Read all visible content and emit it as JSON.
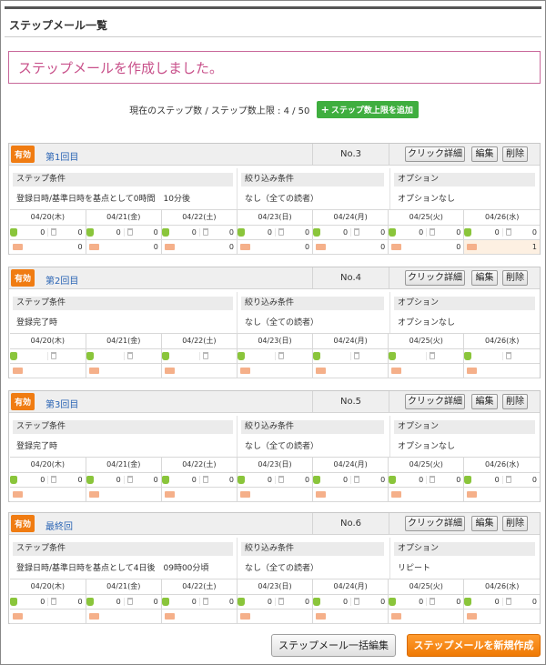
{
  "page": {
    "title": "ステップメール一覧",
    "notice": "ステップメールを作成しました。",
    "count_text": "現在のステップ数 / ステップ数上限 :  4 / 50",
    "add_limit_button": "ステップ数上限を追加"
  },
  "labels": {
    "step_condition": "ステップ条件",
    "filter_condition": "絞り込み条件",
    "option": "オプション",
    "click_detail": "クリック詳細",
    "edit": "編集",
    "delete": "削除"
  },
  "dates": [
    "04/20(木)",
    "04/21(金)",
    "04/22(土)",
    "04/23(日)",
    "04/24(月)",
    "04/25(火)",
    "04/26(水)"
  ],
  "steps": [
    {
      "status": "有効",
      "name": "第1回目",
      "no": "No.3",
      "step_condition": "登録日時/基準日時を基点として0時間　10分後",
      "filter": "なし（全ての読者）",
      "option": "オプションなし",
      "days": [
        {
          "a": "0",
          "b": "0",
          "mail": "0"
        },
        {
          "a": "0",
          "b": "0",
          "mail": "0"
        },
        {
          "a": "0",
          "b": "0",
          "mail": "0"
        },
        {
          "a": "0",
          "b": "0",
          "mail": "0"
        },
        {
          "a": "0",
          "b": "0",
          "mail": "0"
        },
        {
          "a": "0",
          "b": "0",
          "mail": "0"
        },
        {
          "a": "0",
          "b": "0",
          "mail": "1"
        }
      ]
    },
    {
      "status": "有効",
      "name": "第2回目",
      "no": "No.4",
      "step_condition": "登録完了時",
      "filter": "なし（全ての読者）",
      "option": "オプションなし",
      "days": [
        {},
        {},
        {},
        {},
        {},
        {},
        {}
      ]
    },
    {
      "status": "有効",
      "name": "第3回目",
      "no": "No.5",
      "step_condition": "登録完了時",
      "filter": "なし（全ての読者）",
      "option": "オプションなし",
      "days": [
        {
          "a": "0",
          "b": "0"
        },
        {
          "a": "0",
          "b": "0"
        },
        {
          "a": "0",
          "b": "0"
        },
        {
          "a": "0",
          "b": "0"
        },
        {
          "a": "0",
          "b": "0"
        },
        {
          "a": "0",
          "b": "0"
        },
        {
          "a": "0",
          "b": "0"
        }
      ]
    },
    {
      "status": "有効",
      "name": "最終回",
      "no": "No.6",
      "step_condition": "登録日時/基準日時を基点として4日後　09時00分頃",
      "filter": "なし（全ての読者）",
      "option": "リピート",
      "days": [
        {
          "a": "0",
          "b": "0"
        },
        {
          "a": "0",
          "b": "0"
        },
        {
          "a": "0",
          "b": "0"
        },
        {
          "a": "0",
          "b": "0"
        },
        {
          "a": "0",
          "b": "0"
        },
        {
          "a": "0",
          "b": "0"
        },
        {
          "a": "0",
          "b": "0"
        }
      ]
    }
  ],
  "footer": {
    "bulk_edit": "ステップメール一括編集",
    "create_new": "ステップメールを新規作成"
  }
}
